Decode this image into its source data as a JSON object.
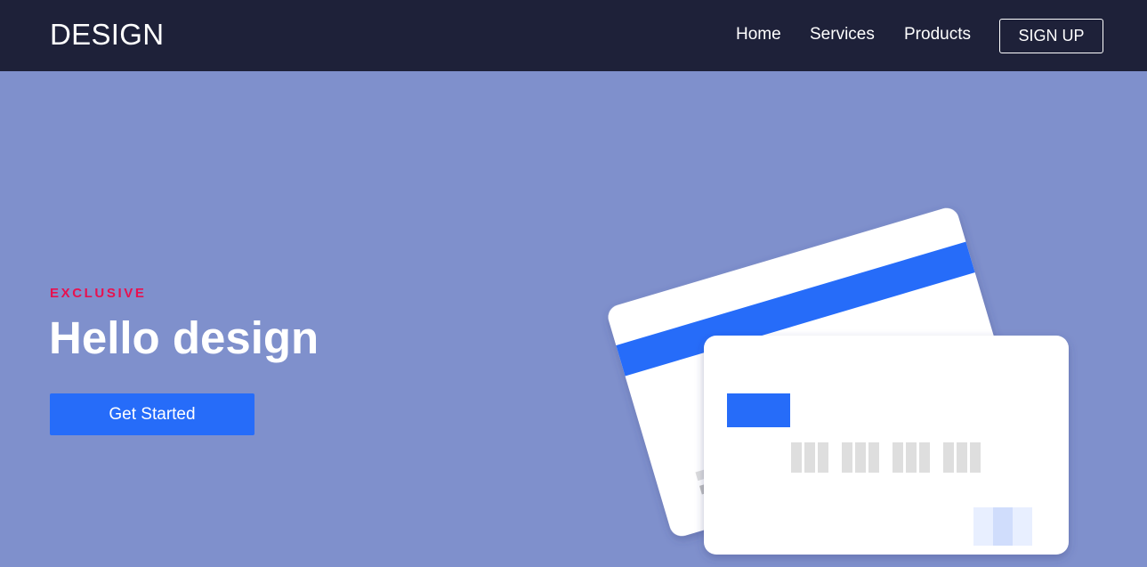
{
  "nav": {
    "logo": "DESIGN",
    "links": [
      "Home",
      "Services",
      "Products"
    ],
    "signup_label": "SIGN UP"
  },
  "hero": {
    "eyebrow": "EXCLUSIVE",
    "title": "Hello design",
    "cta_label": "Get Started"
  },
  "illustration": {
    "icon": "credit-cards-illustration",
    "stripe_color": "#266cf9",
    "chip_color": "#266cf9"
  },
  "colors": {
    "navbar": "#1e2139",
    "background": "#7f90cc",
    "accent": "#e8114f",
    "button": "#266cf9"
  }
}
